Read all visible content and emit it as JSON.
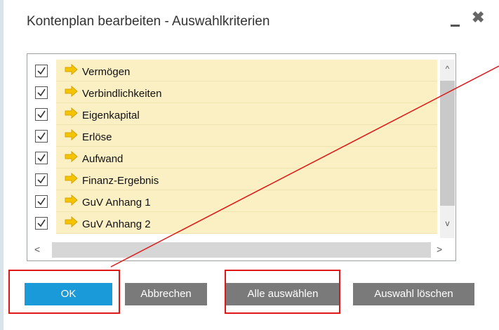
{
  "dialog": {
    "title": "Kontenplan bearbeiten - Auswahlkriterien",
    "minimize_label": "_",
    "close_label": "✖"
  },
  "list": {
    "items": [
      {
        "label": "Vermögen",
        "checked": true
      },
      {
        "label": "Verbindlichkeiten",
        "checked": true
      },
      {
        "label": "Eigenkapital",
        "checked": true
      },
      {
        "label": "Erlöse",
        "checked": true
      },
      {
        "label": "Aufwand",
        "checked": true
      },
      {
        "label": "Finanz-Ergebnis",
        "checked": true
      },
      {
        "label": "GuV Anhang 1",
        "checked": true
      },
      {
        "label": "GuV Anhang 2",
        "checked": true
      }
    ],
    "row_color": "#fbf0c4",
    "arrow_color": "#f5c400"
  },
  "scroll": {
    "up": "^",
    "down": "v",
    "left": "<",
    "right": ">"
  },
  "buttons": {
    "ok": "OK",
    "cancel": "Abbrechen",
    "select_all": "Alle auswählen",
    "clear": "Auswahl löschen"
  },
  "colors": {
    "ok_button": "#1a9ad8",
    "secondary_button": "#7a7a7a",
    "highlight": "#e01717"
  }
}
